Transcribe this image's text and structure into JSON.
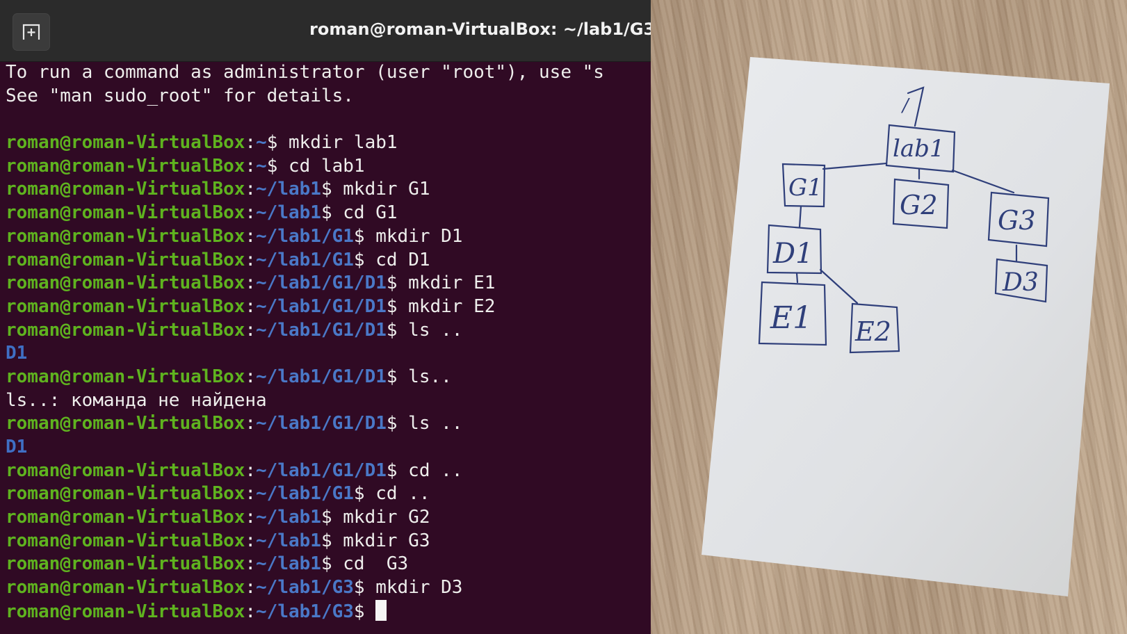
{
  "window": {
    "title": "roman@roman-VirtualBox: ~/lab1/G3"
  },
  "terminal": {
    "intro": [
      "To run a command as administrator (user \"root\"), use \"s",
      "See \"man sudo_root\" for details."
    ],
    "prompt_user": "roman@roman-VirtualBox",
    "lines": [
      {
        "path": "~",
        "cmd": " mkdir lab1"
      },
      {
        "path": "~",
        "cmd": " cd lab1"
      },
      {
        "path": "~/lab1",
        "cmd": " mkdir G1"
      },
      {
        "path": "~/lab1",
        "cmd": " cd G1"
      },
      {
        "path": "~/lab1/G1",
        "cmd": " mkdir D1"
      },
      {
        "path": "~/lab1/G1",
        "cmd": " cd D1"
      },
      {
        "path": "~/lab1/G1/D1",
        "cmd": " mkdir E1"
      },
      {
        "path": "~/lab1/G1/D1",
        "cmd": " mkdir E2"
      },
      {
        "path": "~/lab1/G1/D1",
        "cmd": " ls .."
      },
      {
        "output_dir": "D1"
      },
      {
        "path": "~/lab1/G1/D1",
        "cmd": " ls.."
      },
      {
        "output": "ls..: команда не найдена"
      },
      {
        "path": "~/lab1/G1/D1",
        "cmd": " ls .."
      },
      {
        "output_dir": "D1"
      },
      {
        "path": "~/lab1/G1/D1",
        "cmd": " cd .."
      },
      {
        "path": "~/lab1/G1",
        "cmd": " cd .."
      },
      {
        "path": "~/lab1",
        "cmd": " mkdir G2"
      },
      {
        "path": "~/lab1",
        "cmd": " mkdir G3"
      },
      {
        "path": "~/lab1",
        "cmd": " cd  G3"
      },
      {
        "path": "~/lab1/G3",
        "cmd": " mkdir D3"
      },
      {
        "path": "~/lab1/G3",
        "cmd": " ",
        "cursor": true
      }
    ]
  },
  "sketch": {
    "root": "/",
    "nodes": [
      "lab1",
      "G1",
      "G2",
      "G3",
      "D1",
      "D3",
      "E1",
      "E2"
    ]
  },
  "colors": {
    "terminal_bg": "#300a24",
    "prompt_user": "#5fb31f",
    "prompt_path": "#4a78c7",
    "text": "#eeeeec"
  },
  "icons": {
    "new_tab": "new-tab-icon"
  }
}
